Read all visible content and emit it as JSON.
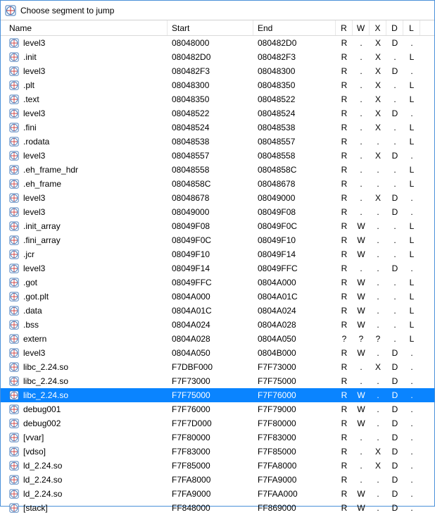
{
  "window": {
    "title": "Choose segment to jump"
  },
  "columns": {
    "name": "Name",
    "start": "Start",
    "end": "End",
    "r": "R",
    "w": "W",
    "x": "X",
    "d": "D",
    "l": "L"
  },
  "selected_index": 25,
  "segments": [
    {
      "name": "level3",
      "start": "08048000",
      "end": "080482D0",
      "r": "R",
      "w": ".",
      "x": "X",
      "d": "D",
      "l": "."
    },
    {
      "name": ".init",
      "start": "080482D0",
      "end": "080482F3",
      "r": "R",
      "w": ".",
      "x": "X",
      "d": ".",
      "l": "L"
    },
    {
      "name": "level3",
      "start": "080482F3",
      "end": "08048300",
      "r": "R",
      "w": ".",
      "x": "X",
      "d": "D",
      "l": "."
    },
    {
      "name": ".plt",
      "start": "08048300",
      "end": "08048350",
      "r": "R",
      "w": ".",
      "x": "X",
      "d": ".",
      "l": "L"
    },
    {
      "name": ".text",
      "start": "08048350",
      "end": "08048522",
      "r": "R",
      "w": ".",
      "x": "X",
      "d": ".",
      "l": "L"
    },
    {
      "name": "level3",
      "start": "08048522",
      "end": "08048524",
      "r": "R",
      "w": ".",
      "x": "X",
      "d": "D",
      "l": "."
    },
    {
      "name": ".fini",
      "start": "08048524",
      "end": "08048538",
      "r": "R",
      "w": ".",
      "x": "X",
      "d": ".",
      "l": "L"
    },
    {
      "name": ".rodata",
      "start": "08048538",
      "end": "08048557",
      "r": "R",
      "w": ".",
      "x": ".",
      "d": ".",
      "l": "L"
    },
    {
      "name": "level3",
      "start": "08048557",
      "end": "08048558",
      "r": "R",
      "w": ".",
      "x": "X",
      "d": "D",
      "l": "."
    },
    {
      "name": ".eh_frame_hdr",
      "start": "08048558",
      "end": "0804858C",
      "r": "R",
      "w": ".",
      "x": ".",
      "d": ".",
      "l": "L"
    },
    {
      "name": ".eh_frame",
      "start": "0804858C",
      "end": "08048678",
      "r": "R",
      "w": ".",
      "x": ".",
      "d": ".",
      "l": "L"
    },
    {
      "name": "level3",
      "start": "08048678",
      "end": "08049000",
      "r": "R",
      "w": ".",
      "x": "X",
      "d": "D",
      "l": "."
    },
    {
      "name": "level3",
      "start": "08049000",
      "end": "08049F08",
      "r": "R",
      "w": ".",
      "x": ".",
      "d": "D",
      "l": "."
    },
    {
      "name": ".init_array",
      "start": "08049F08",
      "end": "08049F0C",
      "r": "R",
      "w": "W",
      "x": ".",
      "d": ".",
      "l": "L"
    },
    {
      "name": ".fini_array",
      "start": "08049F0C",
      "end": "08049F10",
      "r": "R",
      "w": "W",
      "x": ".",
      "d": ".",
      "l": "L"
    },
    {
      "name": ".jcr",
      "start": "08049F10",
      "end": "08049F14",
      "r": "R",
      "w": "W",
      "x": ".",
      "d": ".",
      "l": "L"
    },
    {
      "name": "level3",
      "start": "08049F14",
      "end": "08049FFC",
      "r": "R",
      "w": ".",
      "x": ".",
      "d": "D",
      "l": "."
    },
    {
      "name": ".got",
      "start": "08049FFC",
      "end": "0804A000",
      "r": "R",
      "w": "W",
      "x": ".",
      "d": ".",
      "l": "L"
    },
    {
      "name": ".got.plt",
      "start": "0804A000",
      "end": "0804A01C",
      "r": "R",
      "w": "W",
      "x": ".",
      "d": ".",
      "l": "L"
    },
    {
      "name": ".data",
      "start": "0804A01C",
      "end": "0804A024",
      "r": "R",
      "w": "W",
      "x": ".",
      "d": ".",
      "l": "L"
    },
    {
      "name": ".bss",
      "start": "0804A024",
      "end": "0804A028",
      "r": "R",
      "w": "W",
      "x": ".",
      "d": ".",
      "l": "L"
    },
    {
      "name": "extern",
      "start": "0804A028",
      "end": "0804A050",
      "r": "?",
      "w": "?",
      "x": "?",
      "d": ".",
      "l": "L"
    },
    {
      "name": "level3",
      "start": "0804A050",
      "end": "0804B000",
      "r": "R",
      "w": "W",
      "x": ".",
      "d": "D",
      "l": "."
    },
    {
      "name": "libc_2.24.so",
      "start": "F7DBF000",
      "end": "F7F73000",
      "r": "R",
      "w": ".",
      "x": "X",
      "d": "D",
      "l": "."
    },
    {
      "name": "libc_2.24.so",
      "start": "F7F73000",
      "end": "F7F75000",
      "r": "R",
      "w": ".",
      "x": ".",
      "d": "D",
      "l": "."
    },
    {
      "name": "libc_2.24.so",
      "start": "F7F75000",
      "end": "F7F76000",
      "r": "R",
      "w": "W",
      "x": ".",
      "d": "D",
      "l": "."
    },
    {
      "name": "debug001",
      "start": "F7F76000",
      "end": "F7F79000",
      "r": "R",
      "w": "W",
      "x": ".",
      "d": "D",
      "l": "."
    },
    {
      "name": "debug002",
      "start": "F7F7D000",
      "end": "F7F80000",
      "r": "R",
      "w": "W",
      "x": ".",
      "d": "D",
      "l": "."
    },
    {
      "name": "[vvar]",
      "start": "F7F80000",
      "end": "F7F83000",
      "r": "R",
      "w": ".",
      "x": ".",
      "d": "D",
      "l": "."
    },
    {
      "name": "[vdso]",
      "start": "F7F83000",
      "end": "F7F85000",
      "r": "R",
      "w": ".",
      "x": "X",
      "d": "D",
      "l": "."
    },
    {
      "name": "ld_2.24.so",
      "start": "F7F85000",
      "end": "F7FA8000",
      "r": "R",
      "w": ".",
      "x": "X",
      "d": "D",
      "l": "."
    },
    {
      "name": "ld_2.24.so",
      "start": "F7FA8000",
      "end": "F7FA9000",
      "r": "R",
      "w": ".",
      "x": ".",
      "d": "D",
      "l": "."
    },
    {
      "name": "ld_2.24.so",
      "start": "F7FA9000",
      "end": "F7FAA000",
      "r": "R",
      "w": "W",
      "x": ".",
      "d": "D",
      "l": "."
    },
    {
      "name": "[stack]",
      "start": "FF848000",
      "end": "FF869000",
      "r": "R",
      "w": "W",
      "x": ".",
      "d": "D",
      "l": "."
    }
  ]
}
